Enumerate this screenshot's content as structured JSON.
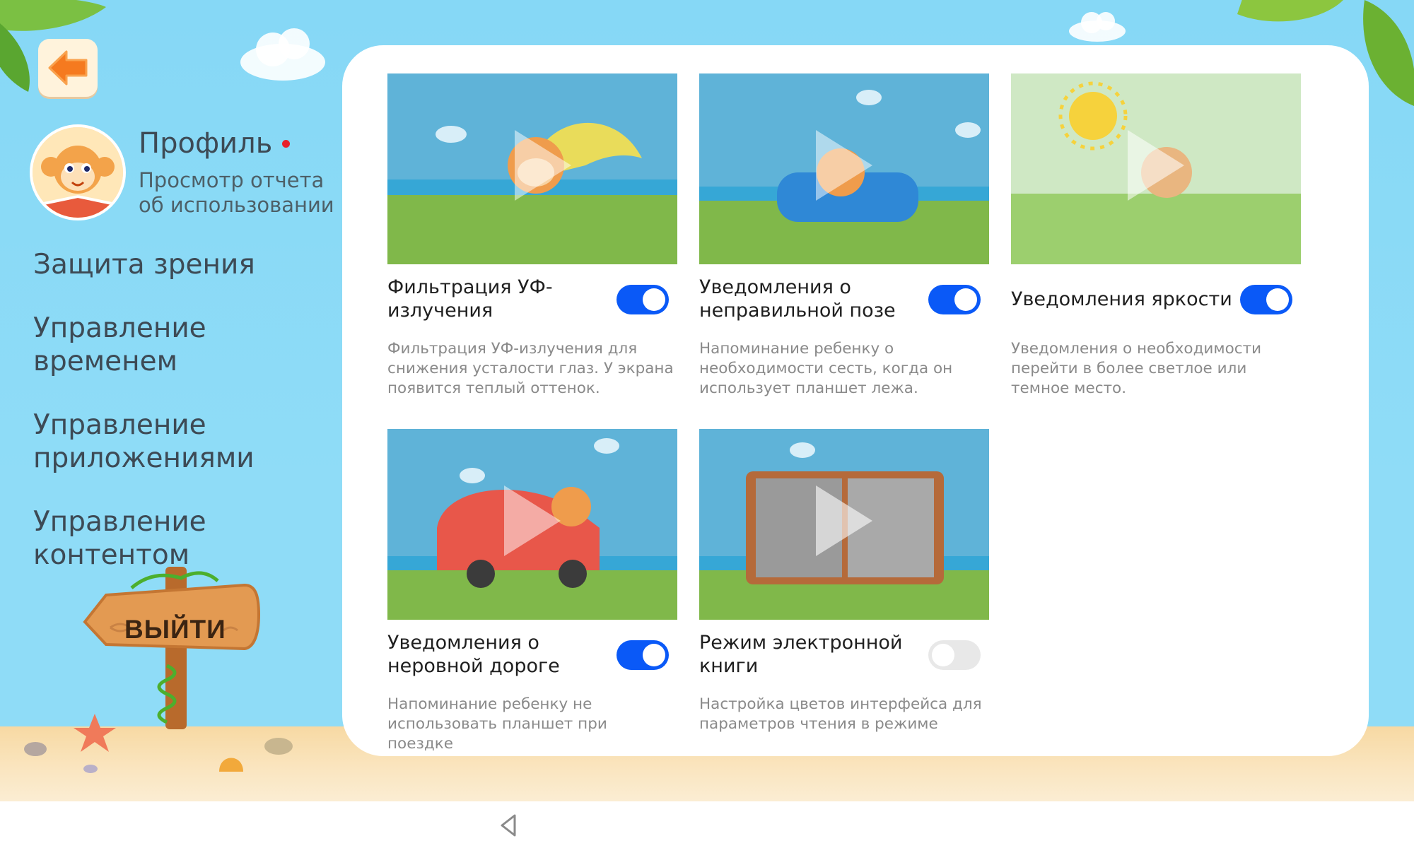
{
  "back_button": {
    "icon": "arrow-left-icon"
  },
  "profile": {
    "title": "Профиль",
    "subtitle": "Просмотр отчета об использовании",
    "has_notification": true
  },
  "menu": [
    {
      "label": "Защита зрения"
    },
    {
      "label": "Управление временем"
    },
    {
      "label": "Управление приложениями"
    },
    {
      "label": "Управление контентом"
    }
  ],
  "exit_sign": {
    "label": "ВЫЙТИ"
  },
  "cards": [
    {
      "title": "Фильтрация УФ-излучения",
      "description": "Фильтрация УФ-излучения для снижения усталости глаз. У экрана появится теплый оттенок.",
      "enabled": true
    },
    {
      "title": "Уведомления о неправильной позе",
      "description": "Напоминание ребенку о необходимости сесть, когда он использует планшет лежа.",
      "enabled": true
    },
    {
      "title": "Уведомления яркости",
      "description": "Уведомления о необходимости перейти в более светлое или темное место.",
      "enabled": true
    },
    {
      "title": "Уведомления о неровной дороге",
      "description": "Напоминание ребенку не использовать планшет при поездке",
      "enabled": true
    },
    {
      "title": "Режим электронной книги",
      "description": "Настройка цветов интерфейса для параметров чтения в режиме",
      "enabled": false
    }
  ],
  "colors": {
    "accent": "#0a59f7",
    "sky": "#8fdcf7",
    "toggle_off": "#e8e8e8"
  }
}
